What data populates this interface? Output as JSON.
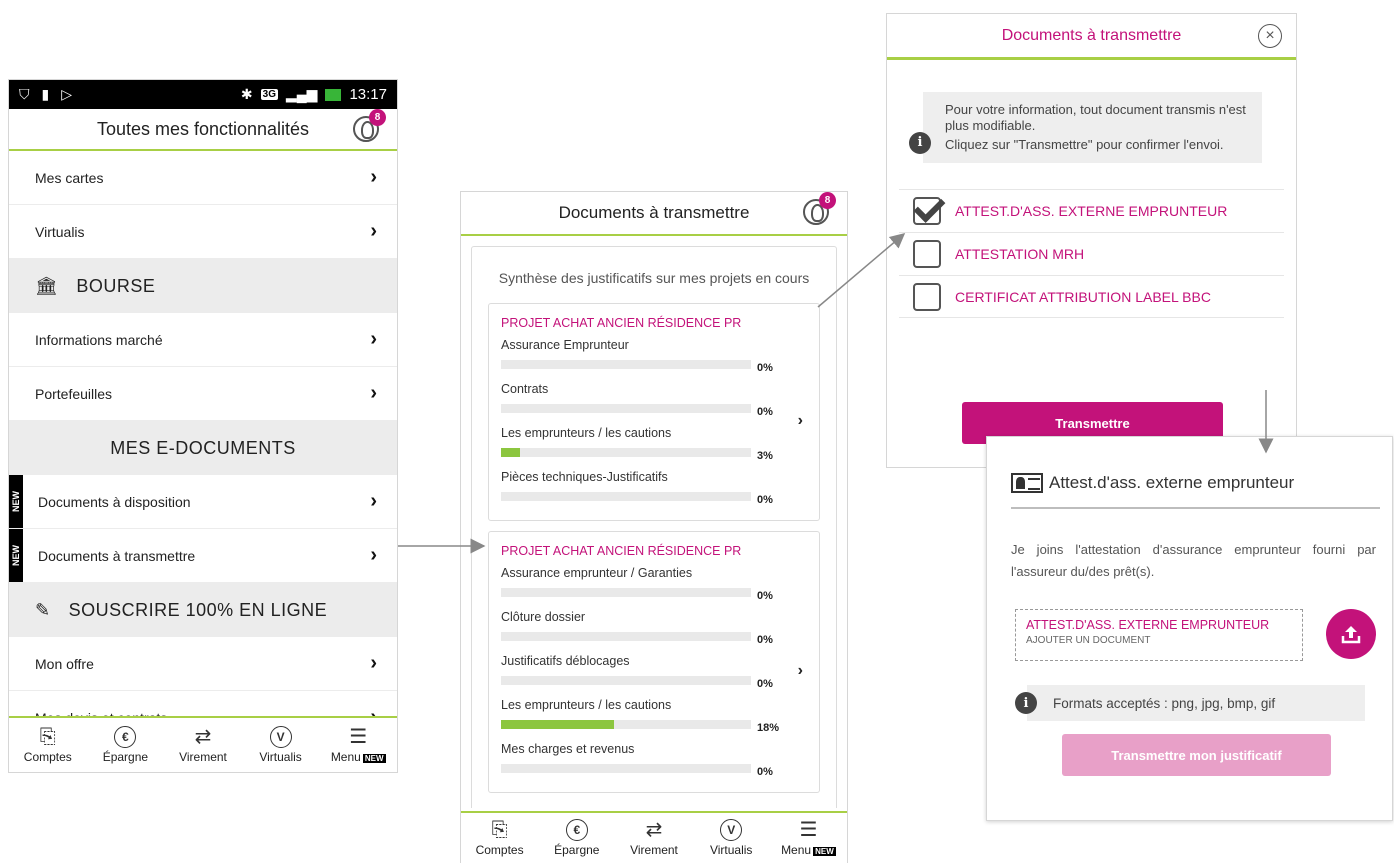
{
  "screen1": {
    "status": {
      "time": "13:17",
      "network": "3G",
      "icons": [
        "shield-icon",
        "sim-icon",
        "play-store-icon",
        "bluetooth-icon",
        "signal-icon",
        "battery-charging-icon"
      ]
    },
    "title": "Toutes mes fonctionnalités",
    "notification_count": "8",
    "items": {
      "mes_cartes": "Mes cartes",
      "virtualis": "Virtualis",
      "bourse": "BOURSE",
      "informations_marche": "Informations marché",
      "portefeuilles": "Portefeuilles",
      "mes_edocuments": "MES E-DOCUMENTS",
      "documents_disposition": "Documents à disposition",
      "documents_transmettre": "Documents à  transmettre",
      "souscrire": "SOUSCRIRE 100% EN LIGNE",
      "mon_offre": "Mon offre",
      "mes_devis": "Mes devis et contrats"
    },
    "new_tag": "NEW"
  },
  "nav": {
    "comptes": "Comptes",
    "epargne": "Épargne",
    "virement": "Virement",
    "virtualis": "Virtualis",
    "menu": "Menu",
    "menu_badge": "NEW"
  },
  "screen2": {
    "title": "Documents à  transmettre",
    "notification_count": "8",
    "summary": "Synthèse des justificatifs sur mes projets en cours",
    "projects": [
      {
        "title": "PROJET ACHAT ANCIEN RÉSIDENCE PR",
        "rows": [
          {
            "label": "Assurance Emprunteur",
            "pct": "0%",
            "value": 0
          },
          {
            "label": "Contrats",
            "pct": "0%",
            "value": 0
          },
          {
            "label": "Les emprunteurs / les cautions",
            "pct": "3%",
            "value": 3
          },
          {
            "label": "Pièces techniques-Justificatifs",
            "pct": "0%",
            "value": 0
          }
        ]
      },
      {
        "title": "PROJET ACHAT ANCIEN RÉSIDENCE PR",
        "rows": [
          {
            "label": "Assurance emprunteur / Garanties",
            "pct": "0%",
            "value": 0
          },
          {
            "label": "Clôture dossier",
            "pct": "0%",
            "value": 0
          },
          {
            "label": "Justificatifs déblocages",
            "pct": "0%",
            "value": 0
          },
          {
            "label": "Les emprunteurs / les cautions",
            "pct": "18%",
            "value": 18
          },
          {
            "label": "Mes charges et revenus",
            "pct": "0%",
            "value": 0
          }
        ]
      }
    ]
  },
  "screen3": {
    "title": "Documents à transmettre",
    "info_line1": "Pour votre information, tout document transmis n'est plus modifiable.",
    "info_line2": "Cliquez sur \"Transmettre\" pour confirmer l'envoi.",
    "documents": [
      {
        "label": "ATTEST.D'ASS. EXTERNE EMPRUNTEUR",
        "checked": true
      },
      {
        "label": "ATTESTATION MRH",
        "checked": false
      },
      {
        "label": "CERTIFICAT ATTRIBUTION LABEL BBC",
        "checked": false
      }
    ],
    "button": "Transmettre"
  },
  "screen4": {
    "title": "Attest.d'ass. externe emprunteur",
    "description": "Je joins l'attestation d'assurance emprunteur fourni par l'assureur du/des prêt(s).",
    "upload_title": "ATTEST.D'ASS. EXTERNE EMPRUNTEUR",
    "upload_sub": "AJOUTER UN DOCUMENT",
    "formats": "Formats acceptés : png, jpg, bmp, gif",
    "button": "Transmettre mon justificatif"
  },
  "colors": {
    "accent": "#c3127a",
    "green": "#a8cf45",
    "progress": "#8cc63f",
    "button_disabled": "#e8a0c8"
  }
}
